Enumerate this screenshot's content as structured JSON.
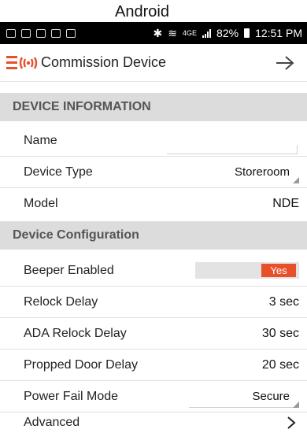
{
  "caption": "Android",
  "status": {
    "battery": "82%",
    "time": "12:51 PM",
    "network": "4GE"
  },
  "app": {
    "title": "Commission Device"
  },
  "sections": {
    "device_information": "DEVICE INFORMATION",
    "device_configuration": "Device Configuration"
  },
  "fields": {
    "name": {
      "label": "Name",
      "value": "",
      "placeholder": ""
    },
    "device_type": {
      "label": "Device Type",
      "value": "Storeroom"
    },
    "model": {
      "label": "Model",
      "value": "NDE"
    },
    "beeper": {
      "label": "Beeper Enabled",
      "value": "Yes"
    },
    "relock_delay": {
      "label": "Relock Delay",
      "value": "3 sec"
    },
    "ada_relock_delay": {
      "label": "ADA Relock Delay",
      "value": "30 sec"
    },
    "propped_door_delay": {
      "label": "Propped Door Delay",
      "value": "20 sec"
    },
    "power_fail_mode": {
      "label": "Power Fail Mode",
      "value": "Secure"
    },
    "advanced": {
      "label": "Advanced"
    }
  },
  "colors": {
    "accent": "#e8502a",
    "section_bg": "#dcdcdc",
    "statusbar": "#000000"
  },
  "icons": {
    "logo": "orange-signal-logo-icon",
    "next": "arrow-right-icon",
    "advanced": "chevron-right-icon"
  }
}
